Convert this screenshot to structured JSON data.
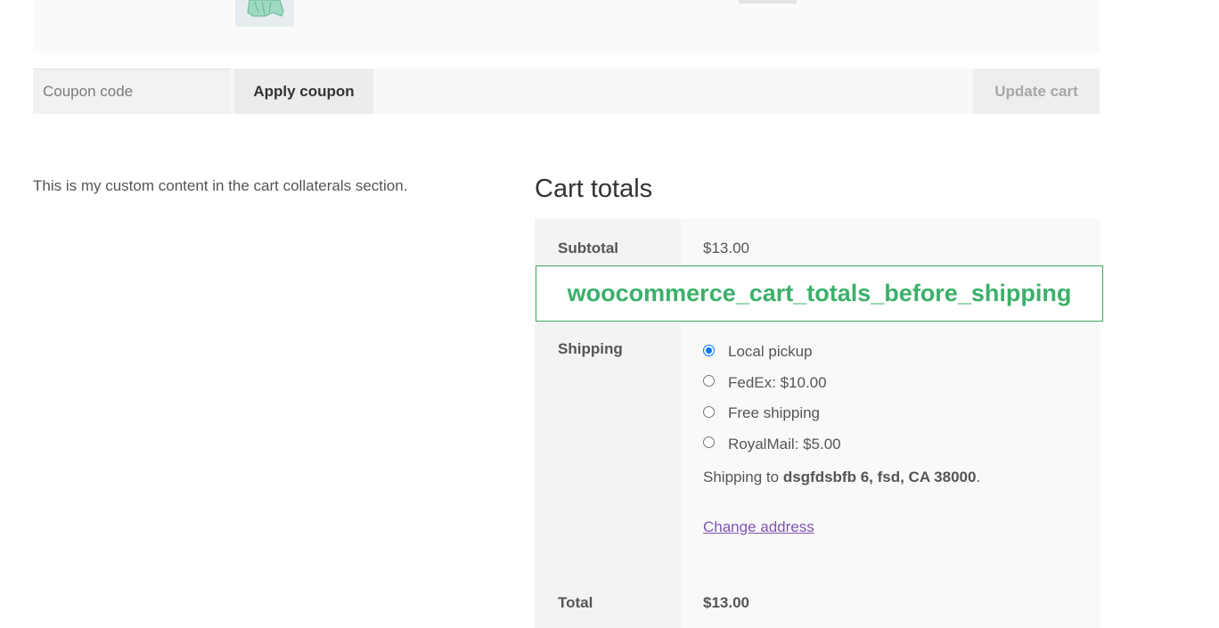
{
  "cart": {
    "thumbnail_icon": "hoodie-product-thumbnail"
  },
  "actions": {
    "coupon_placeholder": "Coupon code",
    "apply_coupon_label": "Apply coupon",
    "update_cart_label": "Update cart"
  },
  "collaterals": {
    "custom_content": "This is my custom content in the cart collaterals section."
  },
  "cart_totals": {
    "title": "Cart totals",
    "subtotal_label": "Subtotal",
    "subtotal_value": "$13.00",
    "hook_label": "woocommerce_cart_totals_before_shipping",
    "hook_color": "#3bb06a",
    "shipping_label": "Shipping",
    "shipping_options": [
      {
        "label": "Local pickup",
        "selected": true
      },
      {
        "label": "FedEx: $10.00",
        "selected": false
      },
      {
        "label": "Free shipping",
        "selected": false
      },
      {
        "label": "RoyalMail: $5.00",
        "selected": false
      }
    ],
    "shipping_to_prefix": "Shipping to",
    "shipping_address": "dsgfdsbfb 6, fsd, CA 38000",
    "shipping_to_suffix": ".",
    "change_address_label": "Change address",
    "link_color": "#7f54b3",
    "total_label": "Total",
    "total_value": "$13.00"
  }
}
